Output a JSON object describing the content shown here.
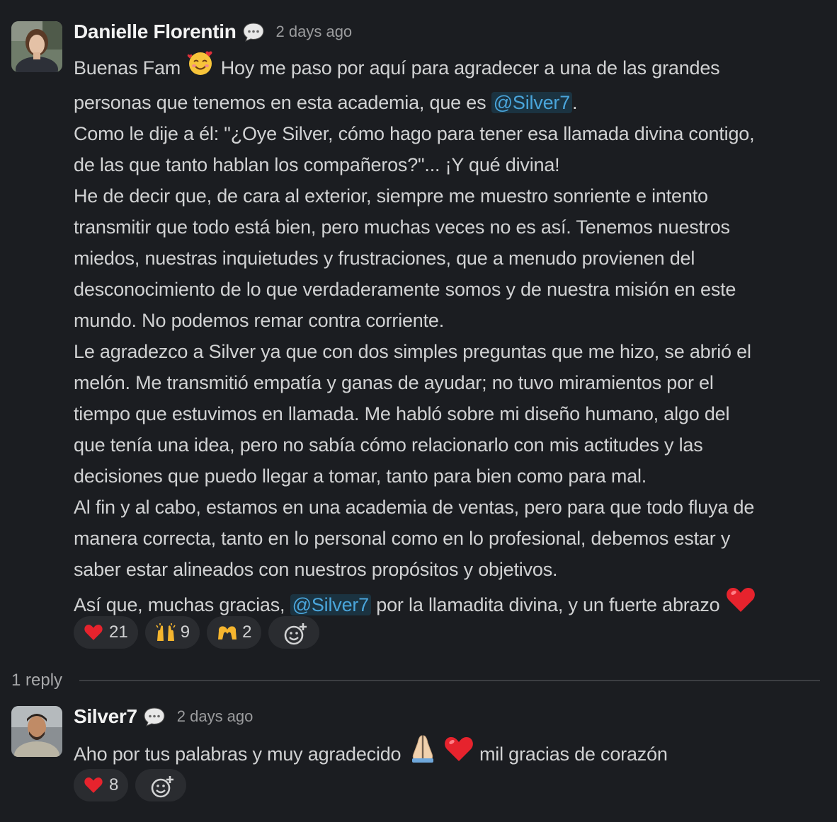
{
  "post": {
    "author": "Danielle Florentin",
    "time": "2 days ago",
    "lines": {
      "l1a": "Buenas Fam ",
      "l1b": " Hoy me paso por aquí para agradecer a una de las grandes",
      "l2a": "personas que tenemos en esta academia, que es ",
      "mention": "@Silver7",
      "l2b": ".",
      "l3": "Como le dije a él: \"¿Oye Silver, cómo hago para tener esa llamada divina contigo,",
      "l4": "de las que tanto hablan los compañeros?\"... ¡Y qué divina!",
      "l5": "He de decir que, de cara al exterior, siempre me muestro sonriente e intento",
      "l6": "transmitir que todo está bien, pero muchas veces no es así. Tenemos nuestros",
      "l7": "miedos, nuestras inquietudes y frustraciones, que a menudo provienen del",
      "l8": "desconocimiento de lo que verdaderamente somos y de nuestra misión en este",
      "l9": "mundo. No podemos remar contra corriente.",
      "l10": "Le agradezco a Silver ya que con dos simples preguntas que me hizo, se abrió el",
      "l11": "melón. Me transmitió empatía y ganas de ayudar; no tuvo miramientos por el",
      "l12": "tiempo que estuvimos en llamada. Me habló sobre mi diseño humano, algo del",
      "l13": "que tenía una idea, pero no sabía cómo relacionarlo con mis actitudes y las",
      "l14": "decisiones que puedo llegar a tomar, tanto para bien como para mal.",
      "l15": "Al fin y al cabo, estamos en una academia de ventas, pero para que todo fluya de",
      "l16": "manera correcta, tanto en lo personal como en lo profesional, debemos estar y",
      "l17": "saber estar alineados con nuestros propósitos y objetivos.",
      "l18a": "Así que, muchas gracias, ",
      "l18b": " por la llamadita divina, y un fuerte abrazo "
    },
    "reactions": [
      {
        "icon": "heart-icon",
        "count": "21"
      },
      {
        "icon": "raised-hands-icon",
        "count": "9"
      },
      {
        "icon": "heart-hands-icon",
        "count": "2"
      }
    ]
  },
  "replies_label": "1 reply",
  "reply": {
    "author": "Silver7",
    "time": "2 days ago",
    "text_a": "Aho por tus palabras y muy agradecido ",
    "text_b": " mil gracias de corazón",
    "reactions": [
      {
        "icon": "heart-icon",
        "count": "8"
      }
    ]
  },
  "colors": {
    "background": "#1b1d21",
    "mention": "#4aa5db",
    "pill": "#2a2c30"
  }
}
